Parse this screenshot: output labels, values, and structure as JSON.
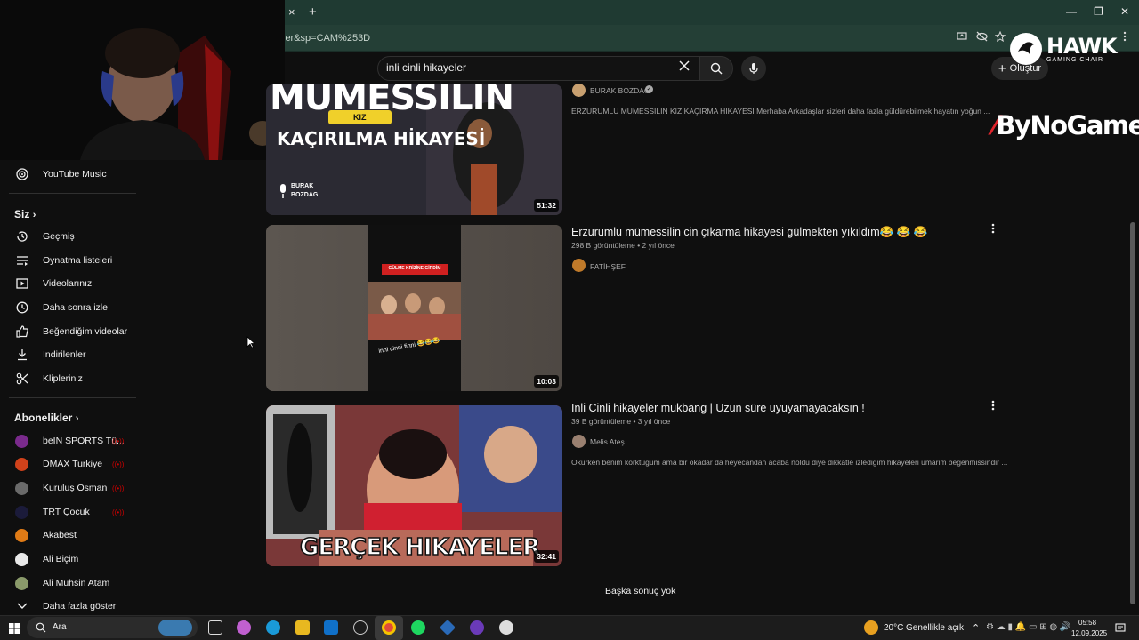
{
  "browser": {
    "url": "ler&sp=CAM%253D",
    "tab_close": "×",
    "tab_new": "+",
    "win_min": "—",
    "win_restore": "❐",
    "win_close": "✕"
  },
  "header": {
    "search_query": "inli cinli hikayeler",
    "create_label": "Oluştur"
  },
  "sidebar": {
    "music_label": "YouTube Music",
    "you_heading": "Siz",
    "you_items": [
      {
        "label": "Geçmiş",
        "icon": "history-icon"
      },
      {
        "label": "Oynatma listeleri",
        "icon": "playlist-icon"
      },
      {
        "label": "Videolarınız",
        "icon": "your-videos-icon"
      },
      {
        "label": "Daha sonra izle",
        "icon": "watch-later-icon"
      },
      {
        "label": "Beğendiğim videolar",
        "icon": "like-icon"
      },
      {
        "label": "İndirilenler",
        "icon": "download-icon"
      },
      {
        "label": "Klipleriniz",
        "icon": "clips-icon"
      }
    ],
    "subs_heading": "Abonelikler",
    "subscriptions": [
      {
        "label": "beIN SPORTS Tü...",
        "color": "#7a2a8c",
        "live": true
      },
      {
        "label": "DMAX Turkiye",
        "color": "#d0421b",
        "live": true
      },
      {
        "label": "Kuruluş Osman",
        "color": "#6a6a6a",
        "live": true
      },
      {
        "label": "TRT Çocuk",
        "color": "#1b1b3a",
        "live": true
      },
      {
        "label": "Akabest",
        "color": "#e07b16",
        "live": false
      },
      {
        "label": "Ali Biçim",
        "color": "#e8e8e8",
        "live": false
      },
      {
        "label": "Ali Muhsin Atam",
        "color": "#8a9a6a",
        "live": false
      }
    ],
    "show_more": "Daha fazla göster",
    "live_mark": "((•))"
  },
  "logos": {
    "hawk": "HAWK",
    "hawk_sub": "GAMING CHAIR",
    "bynogame": "ByNoGame"
  },
  "results": [
    {
      "thumb_title_top": "MÜMESSİLİN",
      "thumb_badge": "KIZ",
      "thumb_title_bottom": "KAÇIRILMA HİKAYESİ",
      "thumb_brand_1": "BURAK",
      "thumb_brand_2": "BOZDAG",
      "duration": "51:32",
      "channel": "BURAK BOZDAĞ",
      "description": "ERZURUMLU MÜMESSİLİN KIZ KAÇIRMA HİKAYESİ Merhaba Arkadaşlar sizleri daha fazla güldürebilmek hayatın yoğun ..."
    },
    {
      "title": "Erzurumlu mümessilin cin çıkarma hikayesi gülmekten yıkıldım😂 😂 😂",
      "meta": "298 B görüntüleme • 2 yıl önce",
      "channel": "FATİHŞEF",
      "thumb_caption": "GÜLME KRİZİNE GİRDİM",
      "thumb_text": "inni cinni finni 😂😂😂",
      "duration": "10:03"
    },
    {
      "title": "Inli Cinli hikayeler mukbang | Uzun süre uyuyamayacaksın !",
      "meta": "39 B görüntüleme • 3 yıl önce",
      "channel": "Melis Ateş",
      "description": "Okurken benim korktuğum ama bir okadar da heyecandan acaba noldu diye dikkatle izledigim hikayeleri umarim beğenmissindir ...",
      "thumb_text": "GERÇEK HIKAYELER",
      "duration": "32:41"
    }
  ],
  "no_more": "Başka sonuç yok",
  "taskbar": {
    "search_label": "Ara",
    "weather": "20°C",
    "weather_desc": "Genellikle açık",
    "time": "05:58",
    "date": "12.09.2025"
  }
}
